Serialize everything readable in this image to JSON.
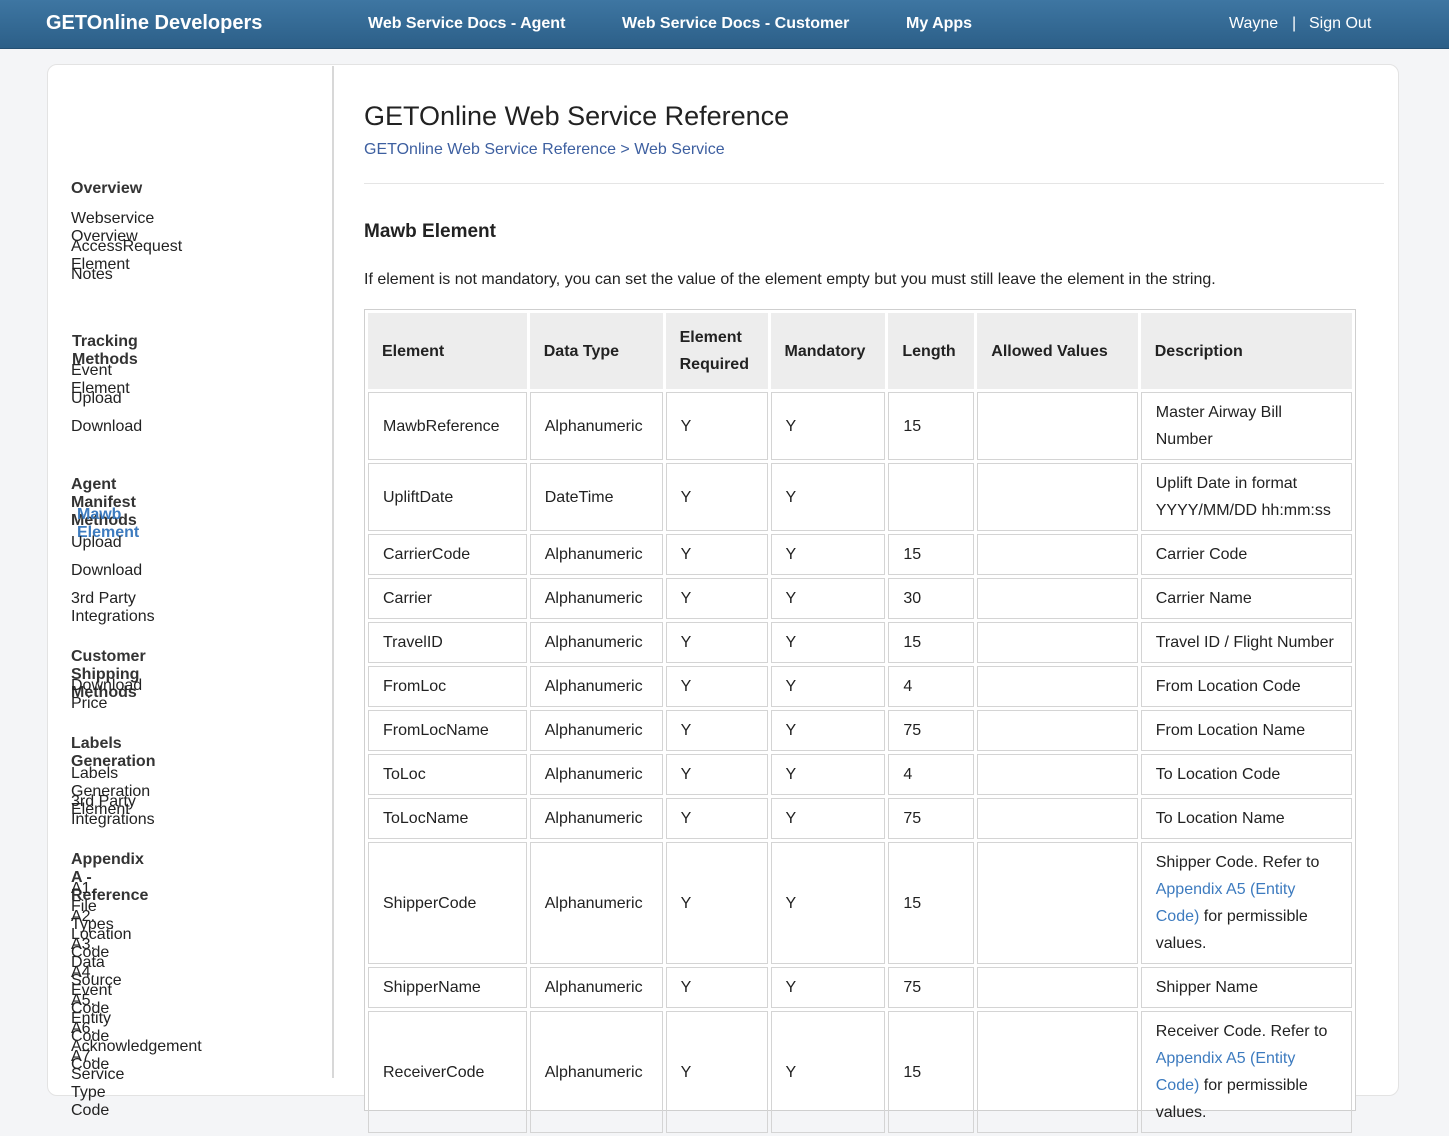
{
  "header": {
    "brand": "GETOnline Developers",
    "nav": [
      "Web Service Docs - Agent",
      "Web Service Docs - Customer",
      "My Apps"
    ],
    "user": "Wayne",
    "separator": "|",
    "signout": "Sign Out"
  },
  "sidebar": {
    "sections": [
      {
        "heading": "Overview",
        "items": [
          "Webservice Overview",
          "AccessRequest Element",
          "Notes"
        ]
      },
      {
        "heading": "Tracking Methods",
        "items": [
          "Event Element",
          "Upload",
          "Download"
        ]
      },
      {
        "heading": "Agent Manifest Methods",
        "items": [
          "Mawb Element",
          "Upload",
          "Download",
          "3rd Party Integrations"
        ]
      },
      {
        "heading": "Customer Shipping Methods",
        "items": [
          "Download Price"
        ]
      },
      {
        "heading": "Labels Generation",
        "items": [
          "Labels Generation Element",
          "3rd Party Integrations"
        ]
      },
      {
        "heading": "Appendix A - Reference",
        "items": [
          "A1. File Types",
          "A2. Location Code",
          "A3. Data Source",
          "A4. Event Code",
          "A5. Entity Code",
          "A6. Acknowledgement Code",
          "A7. Service Type Code"
        ]
      }
    ],
    "active": "Mawb Element"
  },
  "main": {
    "title": "GETOnline Web Service Reference",
    "breadcrumb": {
      "root": "GETOnline Web Service Reference",
      "separator": ">",
      "current": "Web Service"
    },
    "section_title": "Mawb Element",
    "intro": "If element is not mandatory, you can set the value of the element empty but you must still leave the element in the string."
  },
  "table": {
    "headers": [
      "Element",
      "Data Type",
      "Element Required",
      "Mandatory",
      "Length",
      "Allowed Values",
      "Description"
    ],
    "rows": [
      {
        "element": "MawbReference",
        "type": "Alphanumeric",
        "required": "Y",
        "mandatory": "Y",
        "length": "15",
        "allowed": "",
        "desc": "Master Airway Bill Number"
      },
      {
        "element": "UpliftDate",
        "type": "DateTime",
        "required": "Y",
        "mandatory": "Y",
        "length": "",
        "allowed": "",
        "desc": "Uplift Date in format YYYY/MM/DD hh:mm:ss"
      },
      {
        "element": "CarrierCode",
        "type": "Alphanumeric",
        "required": "Y",
        "mandatory": "Y",
        "length": "15",
        "allowed": "",
        "desc": "Carrier Code"
      },
      {
        "element": "Carrier",
        "type": "Alphanumeric",
        "required": "Y",
        "mandatory": "Y",
        "length": "30",
        "allowed": "",
        "desc": "Carrier Name"
      },
      {
        "element": "TravelID",
        "type": "Alphanumeric",
        "required": "Y",
        "mandatory": "Y",
        "length": "15",
        "allowed": "",
        "desc": "Travel ID / Flight Number"
      },
      {
        "element": "FromLoc",
        "type": "Alphanumeric",
        "required": "Y",
        "mandatory": "Y",
        "length": "4",
        "allowed": "",
        "desc": "From Location Code"
      },
      {
        "element": "FromLocName",
        "type": "Alphanumeric",
        "required": "Y",
        "mandatory": "Y",
        "length": "75",
        "allowed": "",
        "desc": "From Location Name"
      },
      {
        "element": "ToLoc",
        "type": "Alphanumeric",
        "required": "Y",
        "mandatory": "Y",
        "length": "4",
        "allowed": "",
        "desc": "To Location Code"
      },
      {
        "element": "ToLocName",
        "type": "Alphanumeric",
        "required": "Y",
        "mandatory": "Y",
        "length": "75",
        "allowed": "",
        "desc": "To Location Name"
      },
      {
        "element": "ShipperCode",
        "type": "Alphanumeric",
        "required": "Y",
        "mandatory": "Y",
        "length": "15",
        "allowed": "",
        "desc_pre": "Shipper Code. Refer to ",
        "desc_link": "Appendix A5 (Entity Code)",
        "desc_post": " for permissible values."
      },
      {
        "element": "ShipperName",
        "type": "Alphanumeric",
        "required": "Y",
        "mandatory": "Y",
        "length": "75",
        "allowed": "",
        "desc": "Shipper Name"
      },
      {
        "element": "ReceiverCode",
        "type": "Alphanumeric",
        "required": "Y",
        "mandatory": "Y",
        "length": "15",
        "allowed": "",
        "desc_pre": "Receiver Code. Refer to ",
        "desc_link": "Appendix A5 (Entity Code)",
        "desc_post": " for permissible values."
      }
    ]
  },
  "colors": {
    "header_bg": "#2f6690",
    "link": "#3d7bbf",
    "breadcrumb": "#3d5fa0"
  }
}
